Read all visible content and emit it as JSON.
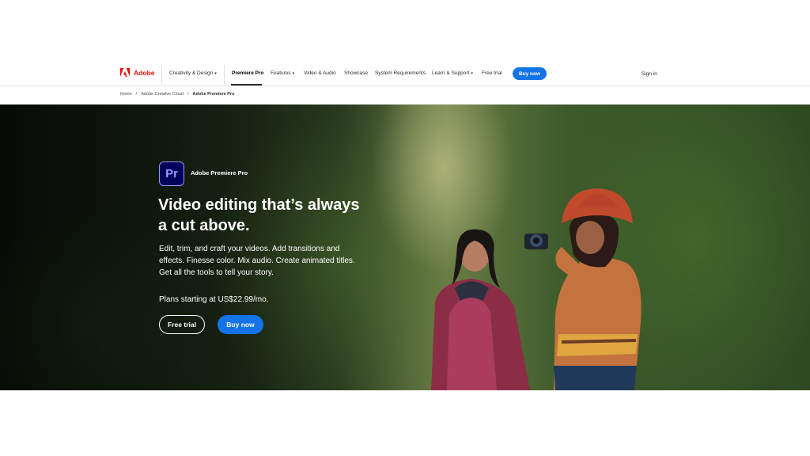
{
  "nav": {
    "brand": "Adobe",
    "items": [
      {
        "label": "Creativity & Design",
        "dropdown": true
      },
      {
        "label": "Premiere Pro",
        "active": true
      },
      {
        "label": "Features",
        "dropdown": true
      },
      {
        "label": "Video & Audio"
      },
      {
        "label": "Showcase"
      },
      {
        "label": "System Requirements"
      },
      {
        "label": "Learn & Support",
        "dropdown": true
      },
      {
        "label": "Free trial"
      }
    ],
    "buy_label": "Buy now",
    "signin_label": "Sign in",
    "chevron": "▾"
  },
  "breadcrumb": {
    "items": [
      "Home",
      "Adobe Creative Cloud",
      "Adobe Premiere Pro"
    ],
    "separator": "/"
  },
  "hero": {
    "app_icon_text": "Pr",
    "product": "Adobe Premiere Pro",
    "headline": "Video editing that’s always a cut above.",
    "description": "Edit, trim, and craft your videos. Add transitions and effects. Finesse color. Mix audio. Create animated titles. Get all the tools to tell your story.",
    "price": "Plans starting at US$22.99/mo.",
    "free_trial_label": "Free trial",
    "buy_label": "Buy now"
  },
  "colors": {
    "adobe_red": "#eb1000",
    "accent_blue": "#1473e6",
    "pr_dark": "#00005b",
    "pr_light": "#9999ff"
  }
}
